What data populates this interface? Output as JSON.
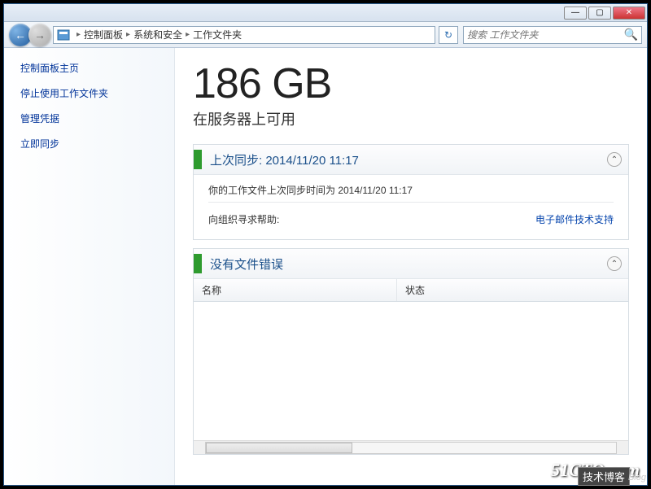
{
  "titlebar": {
    "min": "—",
    "max": "▢",
    "close": "✕"
  },
  "nav": {
    "back": "←",
    "fwd": "→"
  },
  "breadcrumb": {
    "items": [
      "控制面板",
      "系统和安全",
      "工作文件夹"
    ],
    "sep": "▸"
  },
  "search": {
    "placeholder": "搜索 工作文件夹",
    "icon": "🔍"
  },
  "refresh": {
    "icon": "↻"
  },
  "sidebar": {
    "home": "控制面板主页",
    "stop": "停止使用工作文件夹",
    "creds": "管理凭据",
    "syncnow": "立即同步"
  },
  "main": {
    "storage_value": "186 GB",
    "storage_label": "在服务器上可用"
  },
  "sync_panel": {
    "title": "上次同步: 2014/11/20 11:17",
    "body1": "你的工作文件上次同步时间为 2014/11/20 11:17",
    "help_label": "向组织寻求帮助:",
    "help_link": "电子邮件技术支持",
    "toggle": "⌃"
  },
  "errors_panel": {
    "title": "没有文件错误",
    "toggle": "⌃",
    "columns": {
      "name": "名称",
      "status": "状态"
    }
  },
  "watermark": {
    "site": "51CTO.com",
    "blog": "技术博客",
    "blog2": "Blog"
  }
}
